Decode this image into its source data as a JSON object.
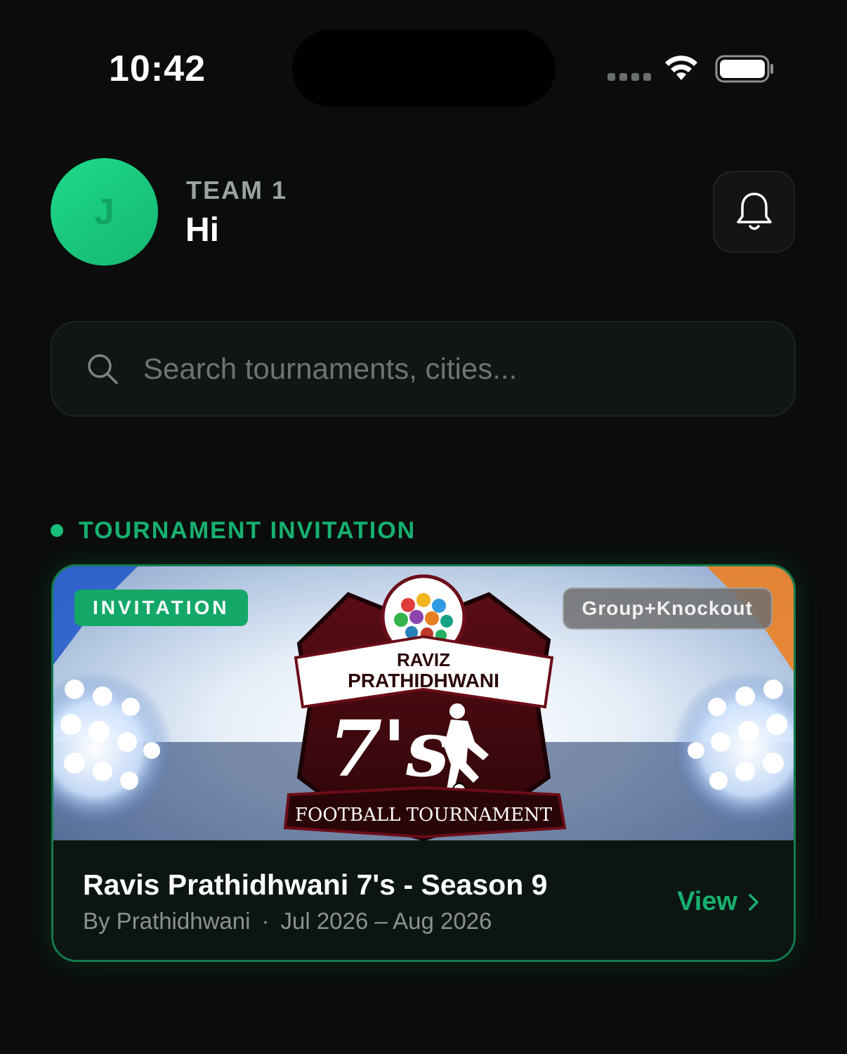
{
  "status_bar": {
    "time": "10:42"
  },
  "header": {
    "avatar_initial": "J",
    "team_name": "TEAM 1",
    "greeting": "Hi",
    "notification_icon": "bell-icon"
  },
  "search": {
    "placeholder": "Search tournaments, cities...",
    "value": "",
    "icon": "search-icon"
  },
  "section": {
    "title": "TOURNAMENT INVITATION"
  },
  "card": {
    "badge": "INVITATION",
    "format": "Group+Knockout",
    "banner_text": {
      "line1": "RAVIZ",
      "line2": "PRATHIDHWANI",
      "logo": "7's",
      "ribbon": "FOOTBALL TOURNAMENT"
    },
    "title": "Ravis Prathidhwani 7's - Season 9",
    "organizer": "By Prathidhwani",
    "separator": "·",
    "dates": "Jul 2026 – Aug 2026",
    "view_label": "View"
  },
  "colors": {
    "background": "#0b0d0c",
    "accent": "#17b06f",
    "avatar": "#1fd98a",
    "card_border": "#137a4c"
  }
}
